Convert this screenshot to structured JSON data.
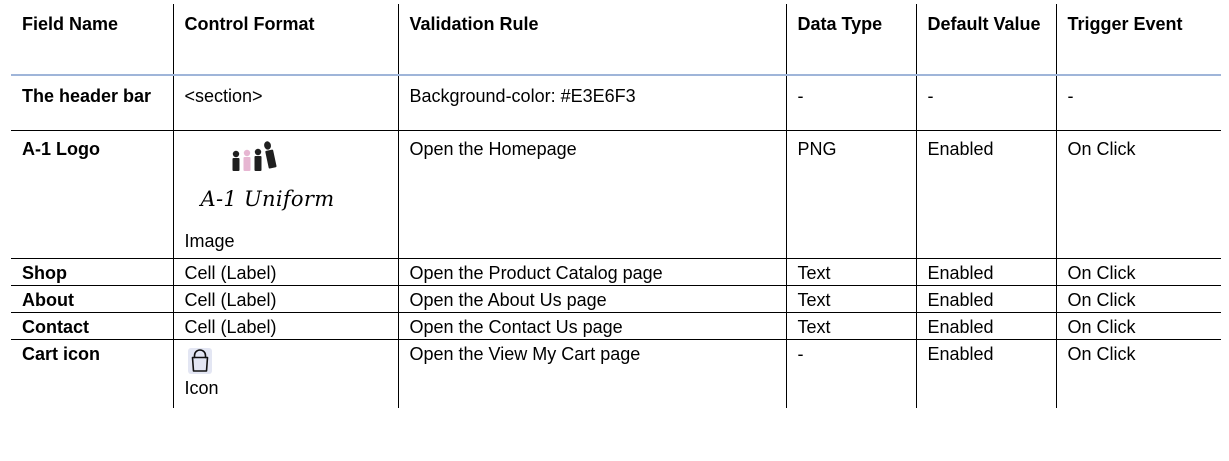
{
  "headers": {
    "field_name": "Field Name",
    "control_format": "Control Format",
    "validation_rule": "Validation Rule",
    "data_type": "Data Type",
    "default_value": "Default Value",
    "trigger_event": "Trigger Event"
  },
  "rows": [
    {
      "field_name": "The header bar",
      "control_format": "<section>",
      "validation_rule": "Background-color: #E3E6F3",
      "data_type": "-",
      "default_value": "-",
      "trigger_event": "-"
    },
    {
      "field_name": "A-1 Logo",
      "control_format": "Image",
      "logo_text": "A-1 Uniform",
      "validation_rule": "Open the Homepage",
      "data_type": "PNG",
      "default_value": "Enabled",
      "trigger_event": "On Click"
    },
    {
      "field_name": "Shop",
      "control_format": "Cell (Label)",
      "validation_rule": "Open the Product Catalog page",
      "data_type": "Text",
      "default_value": "Enabled",
      "trigger_event": "On Click"
    },
    {
      "field_name": "About",
      "control_format": "Cell (Label)",
      "validation_rule": "Open the About Us page",
      "data_type": "Text",
      "default_value": "Enabled",
      "trigger_event": "On Click"
    },
    {
      "field_name": "Contact",
      "control_format": "Cell (Label)",
      "validation_rule": "Open the Contact Us page",
      "data_type": "Text",
      "default_value": "Enabled",
      "trigger_event": "On Click"
    },
    {
      "field_name": "Cart icon",
      "control_format": "Icon",
      "icon": "shopping-bag-icon",
      "validation_rule": "Open the View My Cart page",
      "data_type": "-",
      "default_value": "Enabled",
      "trigger_event": "On Click"
    }
  ],
  "colors": {
    "header_rule": "#9fb5d9",
    "logo_pink": "#e7b6d2",
    "logo_dark": "#1f1f1f",
    "icon_bg": "#e3e6f3"
  }
}
